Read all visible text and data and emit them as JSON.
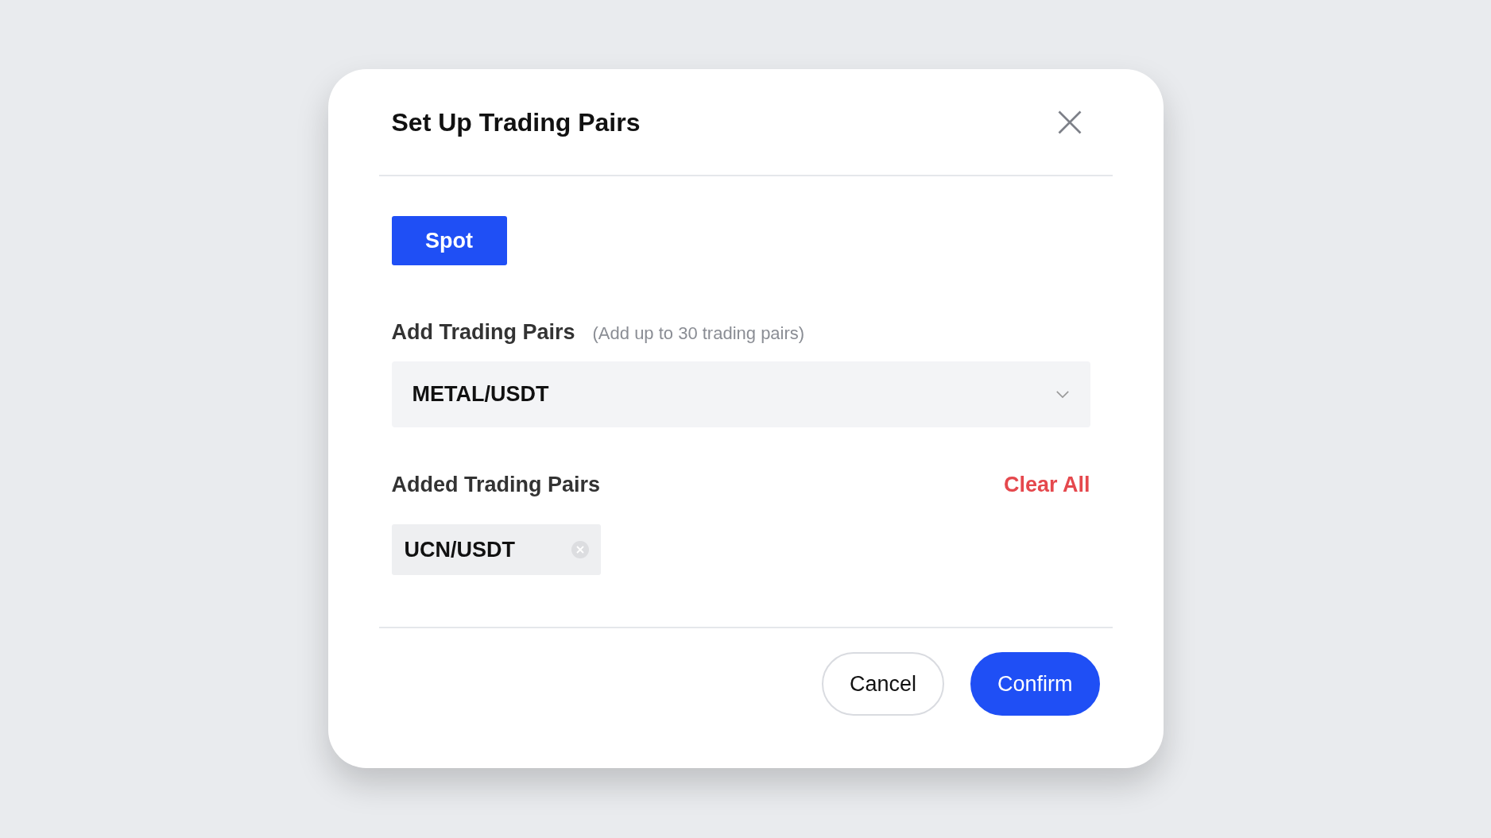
{
  "dialog": {
    "title": "Set Up Trading Pairs"
  },
  "tabs": [
    {
      "label": "Spot",
      "selected": true
    }
  ],
  "add_section": {
    "label": "Add Trading Pairs",
    "hint": "(Add up to 30 trading pairs)",
    "select": {
      "value": "METAL/USDT"
    }
  },
  "added_section": {
    "label": "Added Trading Pairs",
    "clear_label": "Clear All",
    "pairs": [
      {
        "label": "UCN/USDT"
      }
    ]
  },
  "buttons": [
    {
      "label": "Cancel",
      "kind": "secondary"
    },
    {
      "label": "Confirm",
      "kind": "primary"
    }
  ]
}
